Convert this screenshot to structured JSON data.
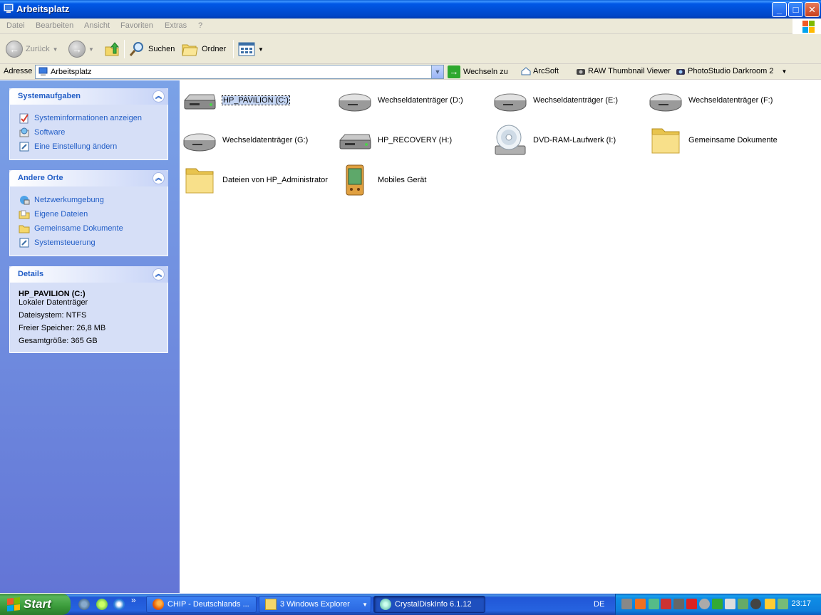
{
  "window": {
    "title": "Arbeitsplatz",
    "buttons": {
      "minimize": "_",
      "maximize": "□",
      "close": "✕"
    }
  },
  "menu": [
    "Datei",
    "Bearbeiten",
    "Ansicht",
    "Favoriten",
    "Extras",
    "?"
  ],
  "toolbar": {
    "back": "Zurück",
    "search": "Suchen",
    "folders": "Ordner"
  },
  "address": {
    "label": "Adresse",
    "value": "Arbeitsplatz",
    "go": "Wechseln zu",
    "links": [
      "ArcSoft",
      "RAW Thumbnail Viewer",
      "PhotoStudio Darkroom 2"
    ]
  },
  "sidebar": {
    "system_tasks": {
      "title": "Systemaufgaben",
      "items": [
        "Systeminformationen anzeigen",
        "Software",
        "Eine Einstellung ändern"
      ]
    },
    "other_places": {
      "title": "Andere Orte",
      "items": [
        "Netzwerkumgebung",
        "Eigene Dateien",
        "Gemeinsame Dokumente",
        "Systemsteuerung"
      ]
    },
    "details": {
      "title": "Details",
      "name": "HP_PAVILION (C:)",
      "type": "Lokaler Datenträger",
      "filesystem": "Dateisystem: NTFS",
      "free": "Freier Speicher: 26,8 MB",
      "total": "Gesamtgröße: 365 GB"
    }
  },
  "items": [
    {
      "label": "HP_PAVILION (C:)",
      "icon": "hard-drive-icon",
      "selected": true
    },
    {
      "label": "Wechseldatenträger (D:)",
      "icon": "removable-drive-icon"
    },
    {
      "label": "Wechseldatenträger (E:)",
      "icon": "removable-drive-icon"
    },
    {
      "label": "Wechseldatenträger (F:)",
      "icon": "removable-drive-icon"
    },
    {
      "label": "Wechseldatenträger (G:)",
      "icon": "removable-drive-icon"
    },
    {
      "label": "HP_RECOVERY (H:)",
      "icon": "hard-drive-icon"
    },
    {
      "label": "DVD-RAM-Laufwerk (I:)",
      "icon": "dvd-drive-icon"
    },
    {
      "label": "Gemeinsame Dokumente",
      "icon": "folder-icon"
    },
    {
      "label": "Dateien von HP_Administrator",
      "icon": "folder-icon"
    },
    {
      "label": "Mobiles Gerät",
      "icon": "mobile-device-icon"
    }
  ],
  "taskbar": {
    "start": "Start",
    "overflow": "»",
    "tasks": [
      {
        "label": "CHIP - Deutschlands ...",
        "icon": "firefox-icon"
      },
      {
        "label": "3 Windows Explorer",
        "icon": "folder-icon"
      },
      {
        "label": "CrystalDiskInfo 6.1.12",
        "icon": "crystaldiskinfo-icon",
        "active": true
      }
    ],
    "language": "DE",
    "clock": "23:17"
  }
}
